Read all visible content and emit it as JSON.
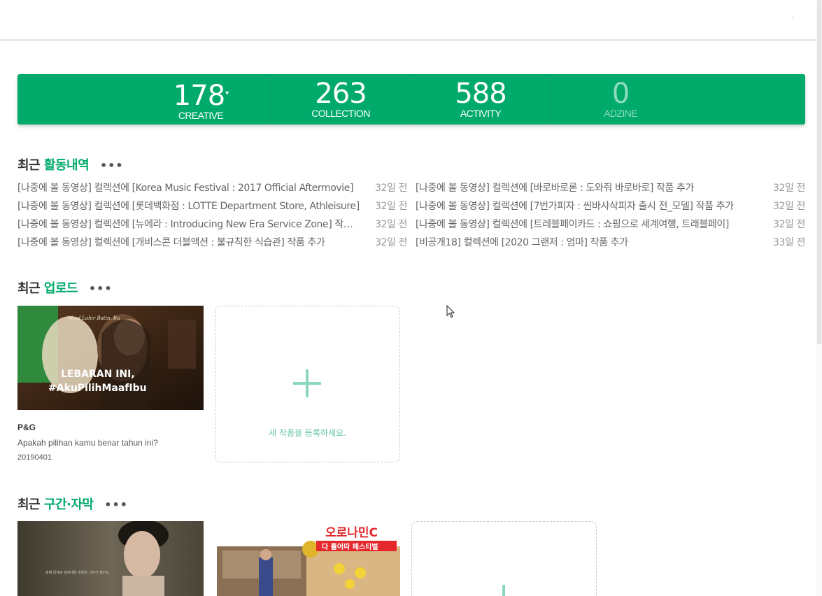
{
  "topbar": {
    "marker": "."
  },
  "stats": [
    {
      "value": "178",
      "label": "CREATIVE",
      "has_dropdown": true
    },
    {
      "value": "263",
      "label": "COLLECTION"
    },
    {
      "value": "588",
      "label": "ACTIVITY"
    },
    {
      "value": "0",
      "label": "ADZINE"
    }
  ],
  "sections": {
    "activity": {
      "prefix": "최근",
      "title": "활동내역",
      "more": "•••"
    },
    "upload": {
      "prefix": "최근",
      "title": "업로드",
      "more": "•••"
    },
    "clips": {
      "prefix": "최근",
      "title": "구간·자막",
      "more": "•••"
    }
  },
  "activity_left": [
    {
      "text": "[나중에 볼 동영상] 컬렉션에 [Korea Music Festival : 2017 Official Aftermovie]",
      "time": "32일 전"
    },
    {
      "text": "[나중에 볼 동영상] 컬렉션에 [롯데백화점 : LOTTE Department Store, Athleisure]",
      "time": "32일 전"
    },
    {
      "text": "[나중에 볼 동영상] 컬렉션에 [뉴에라 : Introducing New Era Service Zone] 작품 추가",
      "time": "32일 전"
    },
    {
      "text": "[나중에 볼 동영상] 컬렉션에 [개비스콘 더블액션 : 불규칙한 식습관] 작품 추가",
      "time": "32일 전"
    }
  ],
  "activity_right": [
    {
      "text": "[나중에 볼 동영상] 컬렉션에 [바로바로론 : 도와줘 바로바로] 작품 추가",
      "time": "32일 전"
    },
    {
      "text": "[나중에 볼 동영상] 컬렉션에 [7번가피자 : 씬바샤삭피자 출시 전_모델] 작품 추가",
      "time": "32일 전"
    },
    {
      "text": "[나중에 볼 동영상] 컬렉션에 [트레블페이카드 : 쇼핑으로 세계여행, 트래블페이]",
      "time": "32일 전"
    },
    {
      "text": "[비공개18] 컬렉션에 [2020 그랜저 : 엄마] 작품 추가",
      "time": "33일 전"
    }
  ],
  "upload_card": {
    "brand": "P&G",
    "description": "Apakah pilihan kamu benar tahun ini?",
    "date": "20190401",
    "thumb_line1": "LEBARAN INI,",
    "thumb_line2": "#AkuPilihMaafIbu",
    "thumb_logo": "Maaf Lahir Batin, Bu"
  },
  "add_work": {
    "label": "새 작품을 등록하세요."
  },
  "clip_cards": [
    {
      "thumb_caption": "화제 남재씨 앞어대한 수많은 신하가 벌어요"
    },
    {
      "thumb_title": "오로나민C",
      "thumb_banner": "다 틀어따 페스티벌"
    }
  ],
  "colors": {
    "accent": "#00aa6b",
    "accent_light": "#8ad8b9",
    "muted_text": "#999999"
  }
}
